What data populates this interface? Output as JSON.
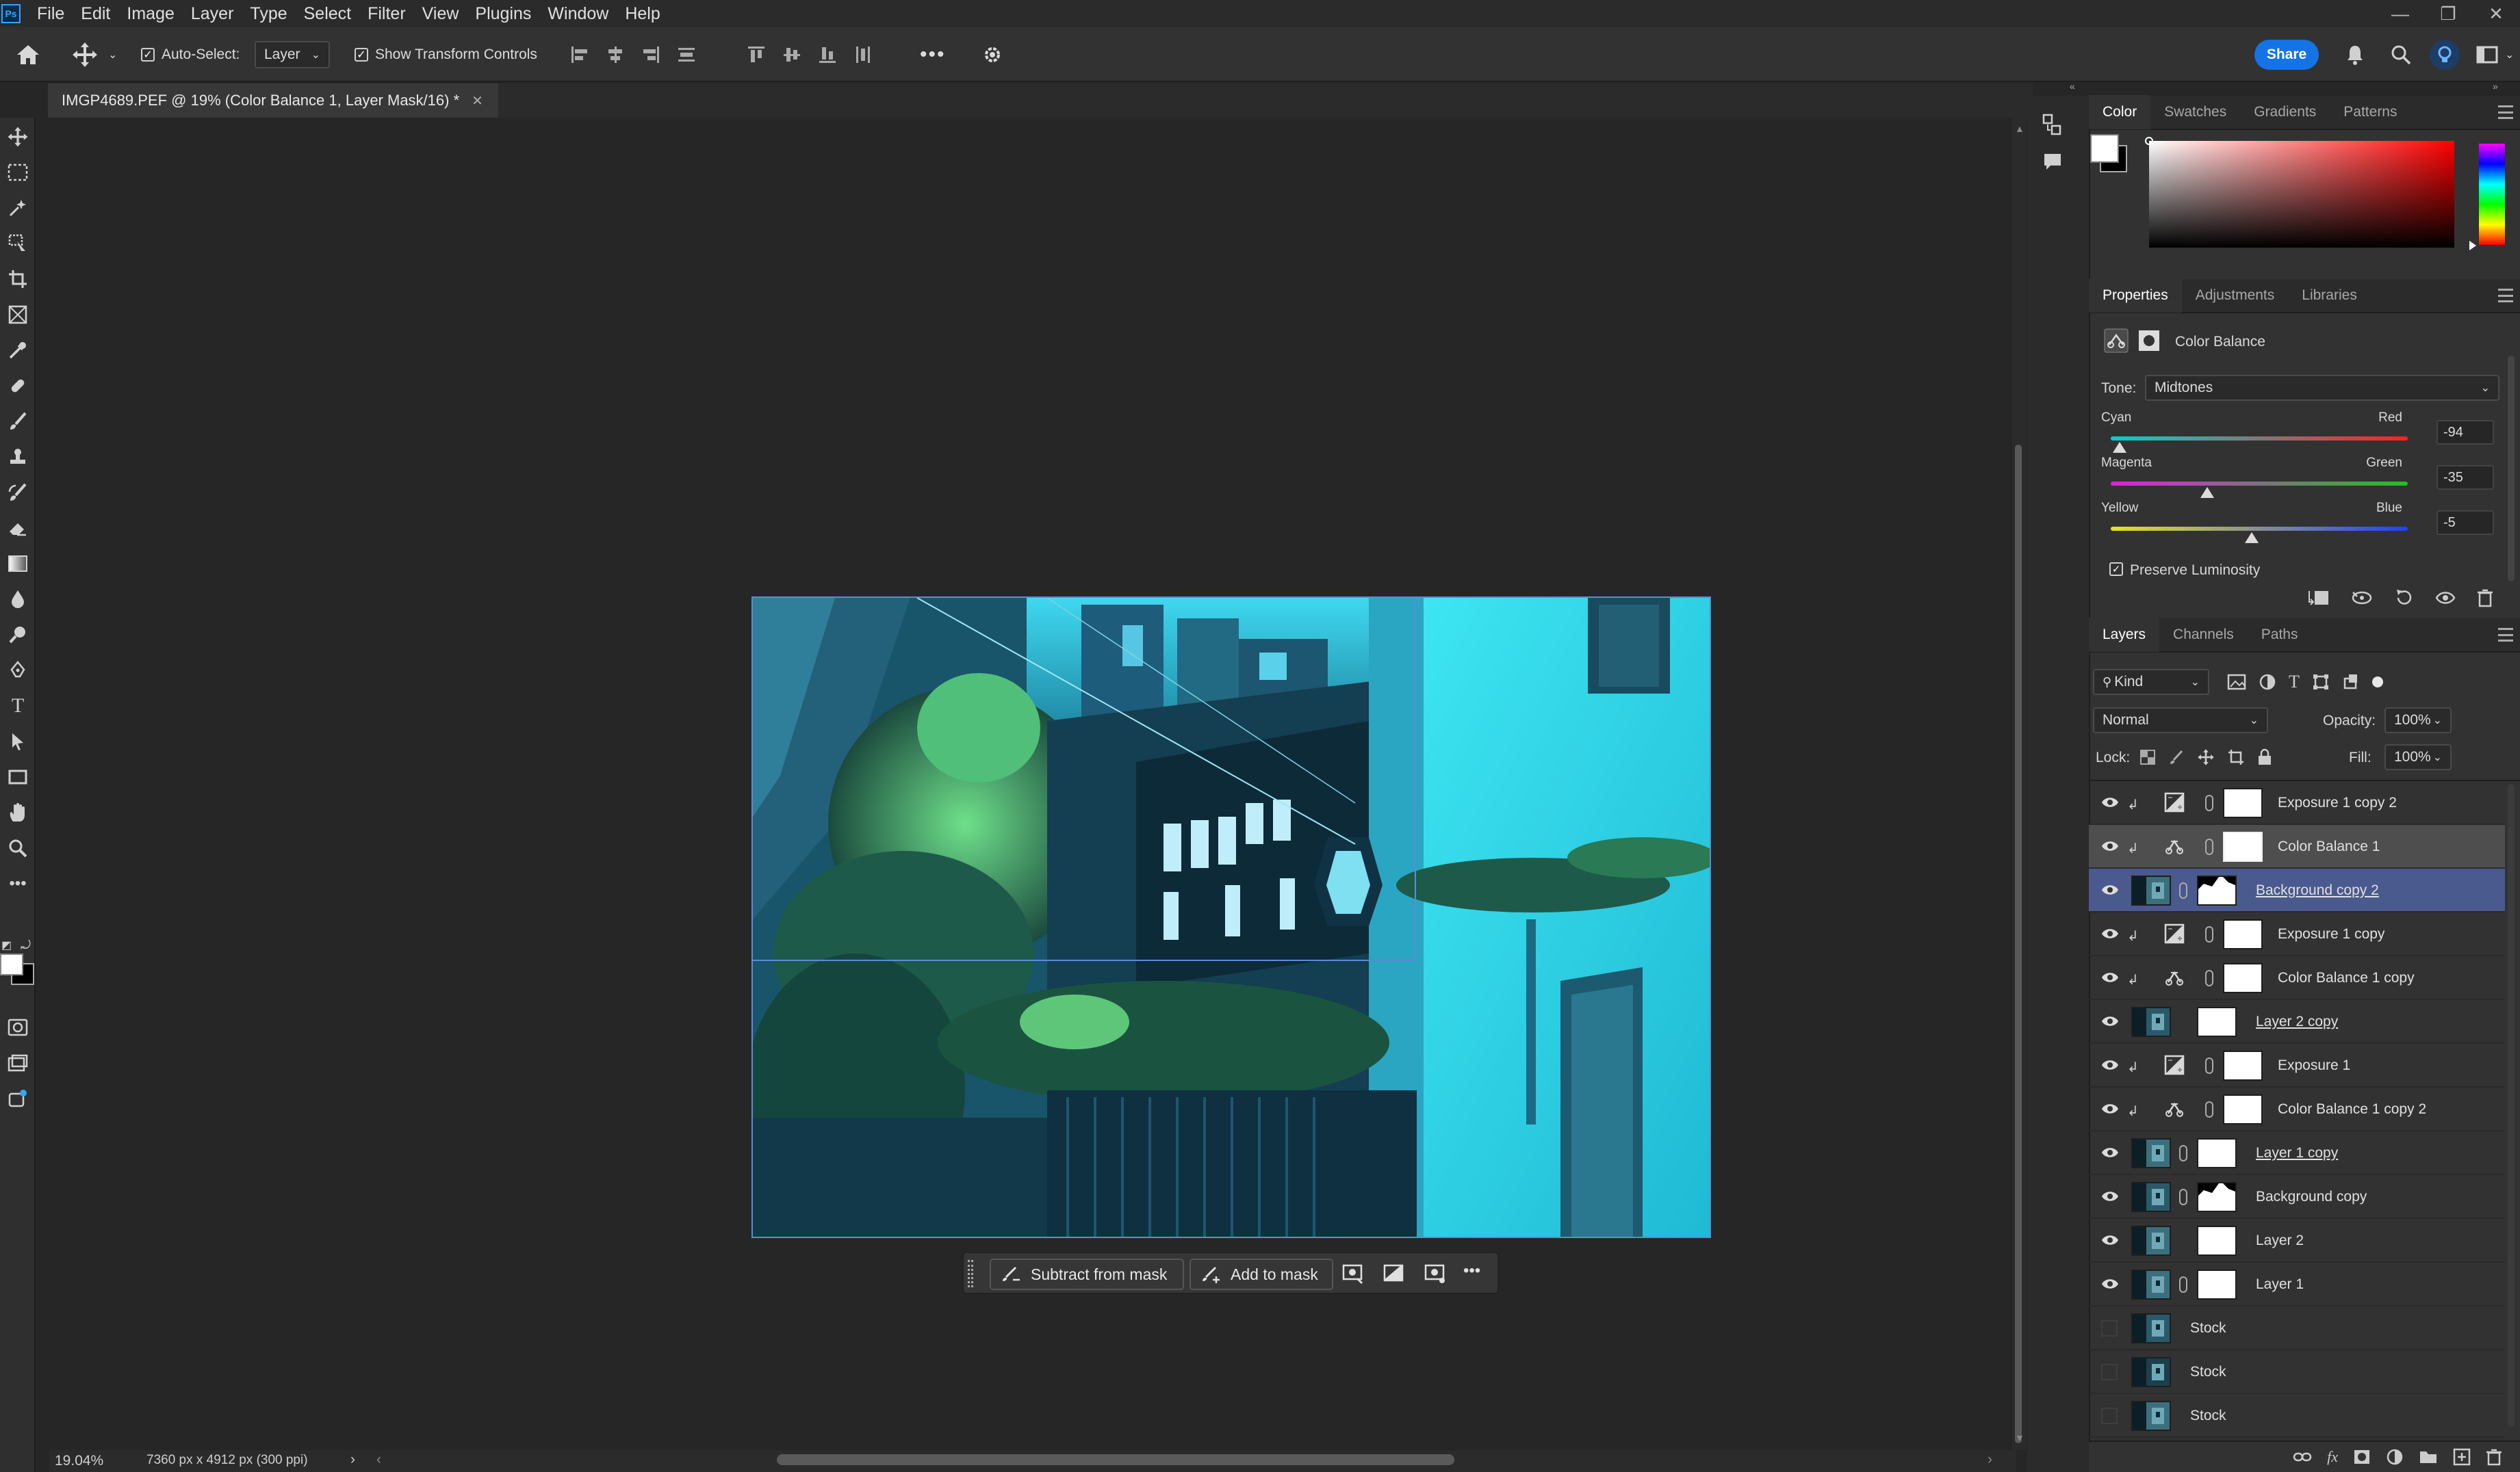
{
  "menu": {
    "items": [
      "File",
      "Edit",
      "Image",
      "Layer",
      "Type",
      "Select",
      "Filter",
      "View",
      "Plugins",
      "Window",
      "Help"
    ]
  },
  "options_bar": {
    "auto_select_label": "Auto-Select:",
    "auto_select_checked": true,
    "auto_select_target": "Layer",
    "show_transform_label": "Show Transform Controls",
    "show_transform_checked": true,
    "share_label": "Share"
  },
  "document": {
    "tab_title": "IMGP4689.PEF @ 19% (Color Balance 1, Layer Mask/16) *",
    "zoom": "19.04%",
    "dimensions": "7360 px x 4912 px (300 ppi)"
  },
  "context_bar": {
    "subtract_label": "Subtract from mask",
    "add_label": "Add to mask"
  },
  "color_panel": {
    "tabs": [
      "Color",
      "Swatches",
      "Gradients",
      "Patterns"
    ],
    "active_tab": "Color",
    "foreground": "#ffffff",
    "background": "#000000",
    "hue": "#ff0000"
  },
  "properties_panel": {
    "tabs": [
      "Properties",
      "Adjustments",
      "Libraries"
    ],
    "active_tab": "Properties",
    "adjustment_title": "Color Balance",
    "tone_label": "Tone:",
    "tone_value": "Midtones",
    "sliders": [
      {
        "left": "Cyan",
        "right": "Red",
        "value": "-94",
        "position": 0.03
      },
      {
        "left": "Magenta",
        "right": "Green",
        "value": "-35",
        "position": 0.325
      },
      {
        "left": "Yellow",
        "right": "Blue",
        "value": "-5",
        "position": 0.475
      }
    ],
    "preserve_luminosity_label": "Preserve Luminosity",
    "preserve_luminosity_checked": true
  },
  "layers_panel": {
    "tabs": [
      "Layers",
      "Channels",
      "Paths"
    ],
    "active_tab": "Layers",
    "filter_kind": "Kind",
    "blend_mode": "Normal",
    "opacity_label": "Opacity:",
    "opacity_value": "100%",
    "lock_label": "Lock:",
    "fill_label": "Fill:",
    "fill_value": "100%",
    "layers": [
      {
        "name": "Exposure 1 copy 2",
        "type": "exposure",
        "visible": true,
        "clipped": true,
        "underline": false,
        "state": ""
      },
      {
        "name": "Color Balance 1",
        "type": "balance",
        "visible": true,
        "clipped": true,
        "underline": false,
        "state": "highlight"
      },
      {
        "name": "Background copy 2",
        "type": "image-mask",
        "visible": true,
        "clipped": false,
        "underline": true,
        "state": "selected"
      },
      {
        "name": "Exposure 1 copy",
        "type": "exposure",
        "visible": true,
        "clipped": true,
        "underline": false,
        "state": ""
      },
      {
        "name": "Color Balance 1 copy",
        "type": "balance",
        "visible": true,
        "clipped": true,
        "underline": false,
        "state": ""
      },
      {
        "name": "Layer 2 copy",
        "type": "image",
        "visible": true,
        "clipped": false,
        "underline": true,
        "state": ""
      },
      {
        "name": "Exposure 1",
        "type": "exposure",
        "visible": true,
        "clipped": true,
        "underline": false,
        "state": ""
      },
      {
        "name": "Color Balance 1 copy 2",
        "type": "balance",
        "visible": true,
        "clipped": true,
        "underline": false,
        "state": ""
      },
      {
        "name": "Layer 1 copy",
        "type": "image-mask",
        "visible": true,
        "clipped": false,
        "underline": true,
        "state": ""
      },
      {
        "name": "Background copy",
        "type": "image-mask",
        "visible": true,
        "clipped": false,
        "underline": false,
        "state": ""
      },
      {
        "name": "Layer 2",
        "type": "image",
        "visible": true,
        "clipped": false,
        "underline": false,
        "state": ""
      },
      {
        "name": "Layer 1",
        "type": "image-mask",
        "visible": true,
        "clipped": false,
        "underline": false,
        "state": ""
      },
      {
        "name": "Stock",
        "type": "plain",
        "visible": false,
        "clipped": false,
        "underline": false,
        "state": ""
      },
      {
        "name": "Stock",
        "type": "plain",
        "visible": false,
        "clipped": false,
        "underline": false,
        "state": ""
      },
      {
        "name": "Stock",
        "type": "plain",
        "visible": false,
        "clipped": false,
        "underline": false,
        "state": ""
      }
    ]
  }
}
